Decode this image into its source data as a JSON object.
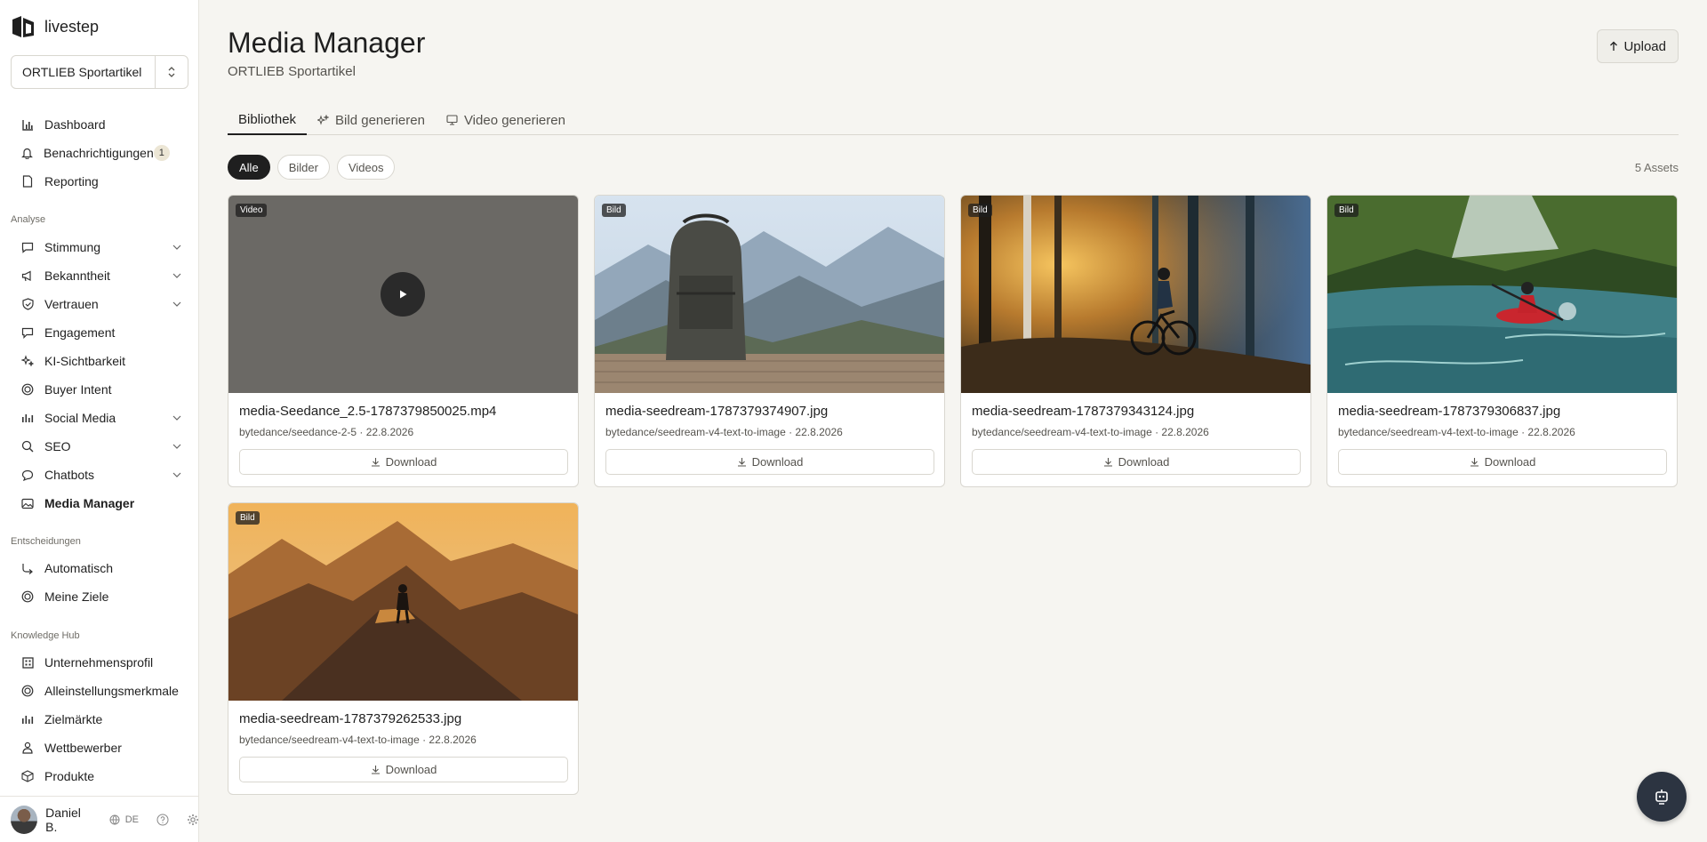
{
  "app": {
    "logo_text": "livestep"
  },
  "org_select": {
    "value": "ORTLIEB Sportartikel"
  },
  "nav_top": [
    {
      "label": "Dashboard",
      "icon": "chart-bars-icon"
    },
    {
      "label": "Benachrichtigungen",
      "icon": "bell-icon",
      "badge": "1"
    },
    {
      "label": "Reporting",
      "icon": "document-icon"
    }
  ],
  "sections": {
    "analyse": "Analyse",
    "entscheidungen": "Entscheidungen",
    "knowledge": "Knowledge Hub"
  },
  "nav_analyse": [
    {
      "label": "Stimmung",
      "icon": "chat-bubble-icon"
    },
    {
      "label": "Bekanntheit",
      "icon": "megaphone-icon"
    },
    {
      "label": "Vertrauen",
      "icon": "shield-check-icon"
    },
    {
      "label": "Engagement",
      "icon": "message-square-icon"
    },
    {
      "label": "KI-Sichtbarkeit",
      "icon": "sparkles-icon"
    },
    {
      "label": "Buyer Intent",
      "icon": "target-icon"
    },
    {
      "label": "Social Media",
      "icon": "bars-icon"
    },
    {
      "label": "SEO",
      "icon": "magnifier-icon"
    },
    {
      "label": "Chatbots",
      "icon": "speech-bubble-icon"
    },
    {
      "label": "Media Manager",
      "icon": "image-icon"
    }
  ],
  "nav_entscheidungen": [
    {
      "label": "Automatisch",
      "icon": "workflow-icon"
    },
    {
      "label": "Meine Ziele",
      "icon": "target-icon"
    }
  ],
  "nav_knowledge": [
    {
      "label": "Unternehmensprofil",
      "icon": "building-icon"
    },
    {
      "label": "Alleinstellungsmerkmale",
      "icon": "target-icon"
    },
    {
      "label": "Zielmärkte",
      "icon": "bars-icon"
    },
    {
      "label": "Wettbewerber",
      "icon": "person-icon"
    },
    {
      "label": "Produkte",
      "icon": "box-icon"
    }
  ],
  "user": {
    "name": "Daniel B.",
    "lang": "DE"
  },
  "page": {
    "title": "Media Manager",
    "subtitle": "ORTLIEB Sportartikel",
    "upload_label": "Upload"
  },
  "tabs": [
    {
      "label": "Bibliothek",
      "active": true
    },
    {
      "label": "Bild generieren",
      "icon": "sparkle-icon"
    },
    {
      "label": "Video generieren",
      "icon": "monitor-icon"
    }
  ],
  "filters": [
    "Alle",
    "Bilder",
    "Videos"
  ],
  "asset_count": "5 Assets",
  "assets": [
    {
      "type": "Video",
      "name": "media-Seedance_2.5-1787379850025.mp4",
      "meta": "bytedance/seedance-2-5 · 22.8.2026",
      "download": "Download"
    },
    {
      "type": "Bild",
      "name": "media-seedream-1787379374907.jpg",
      "meta": "bytedance/seedream-v4-text-to-image · 22.8.2026",
      "download": "Download"
    },
    {
      "type": "Bild",
      "name": "media-seedream-1787379343124.jpg",
      "meta": "bytedance/seedream-v4-text-to-image · 22.8.2026",
      "download": "Download"
    },
    {
      "type": "Bild",
      "name": "media-seedream-1787379306837.jpg",
      "meta": "bytedance/seedream-v4-text-to-image · 22.8.2026",
      "download": "Download"
    },
    {
      "type": "Bild",
      "name": "media-seedream-1787379262533.jpg",
      "meta": "bytedance/seedream-v4-text-to-image · 22.8.2026",
      "download": "Download"
    }
  ]
}
